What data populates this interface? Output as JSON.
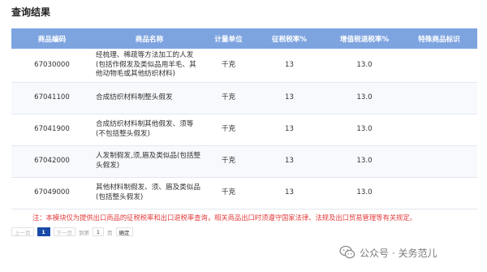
{
  "section_title": "查询结果",
  "columns": [
    "商品编码",
    "商品名称",
    "计量单位",
    "征税税率%",
    "增值税退税率%",
    "特殊商品标识"
  ],
  "rows": [
    {
      "code": "67030000",
      "name": "经梳理、稀疏等方法加工的人发(包括作假发及类似品用羊毛、其他动物毛或其他纺织材料)",
      "unit": "千克",
      "tax_rate": "13",
      "refund_rate": "13.0",
      "special": ""
    },
    {
      "code": "67041100",
      "name": "合成纺织材料制整头假发",
      "unit": "千克",
      "tax_rate": "13",
      "refund_rate": "13.0",
      "special": ""
    },
    {
      "code": "67041900",
      "name": "合成纺织材料制其他假发、须等(不包括整头假发)",
      "unit": "千克",
      "tax_rate": "13",
      "refund_rate": "13.0",
      "special": ""
    },
    {
      "code": "67042000",
      "name": "人发制假发,须,眉及类似品(包括整头假发)",
      "unit": "千克",
      "tax_rate": "13",
      "refund_rate": "13.0",
      "special": ""
    },
    {
      "code": "67049000",
      "name": "其他材料制假发、须、眉及类似品(包括整头假发)",
      "unit": "千克",
      "tax_rate": "13",
      "refund_rate": "13.0",
      "special": ""
    }
  ],
  "note": "注：本模块仅为提供出口商品的征税税率和出口退税率查询，相关商品出口时须遵守国家法律、法规及出口贸易管理等有关规定。",
  "pagination": {
    "prev": "上一页",
    "current": "1",
    "next": "下一页",
    "goto": "到第",
    "input_value": "1",
    "page_suffix": "页",
    "confirm": "确定"
  },
  "watermark": {
    "text": "公众号 · 关务范儿",
    "icon": "wechat-icon"
  },
  "colors": {
    "header_bg": "#7ea4e0",
    "note": "#e23a3a",
    "current_page": "#1a4aa8"
  }
}
